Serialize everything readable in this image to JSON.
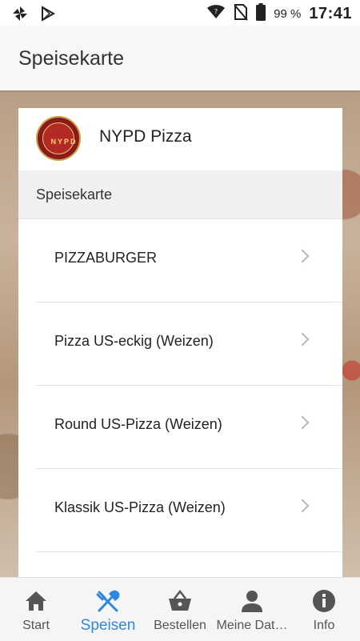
{
  "status_bar": {
    "battery_text": "99 %",
    "time": "17:41",
    "icons": [
      "pinwheel-icon",
      "play-store-icon",
      "wifi-icon",
      "no-sim-icon",
      "battery-icon"
    ]
  },
  "app_bar": {
    "title": "Speisekarte"
  },
  "card": {
    "restaurant_name": "NYPD Pizza",
    "logo_text": "NYPD",
    "section_title": "Speisekarte",
    "items": [
      {
        "label": "PIZZABURGER"
      },
      {
        "label": "Pizza US-eckig (Weizen)"
      },
      {
        "label": "Round US-Pizza (Weizen)"
      },
      {
        "label": "Klassik US-Pizza (Weizen)"
      },
      {
        "label": ""
      }
    ]
  },
  "bottom_nav": {
    "active_color": "#2f88e0",
    "items": [
      {
        "label": "Start",
        "icon": "home-icon"
      },
      {
        "label": "Speisen",
        "icon": "fork-knife-icon",
        "active": true
      },
      {
        "label": "Bestellen",
        "icon": "basket-icon"
      },
      {
        "label": "Meine Dat…",
        "icon": "person-icon"
      },
      {
        "label": "Info",
        "icon": "info-icon"
      }
    ]
  }
}
